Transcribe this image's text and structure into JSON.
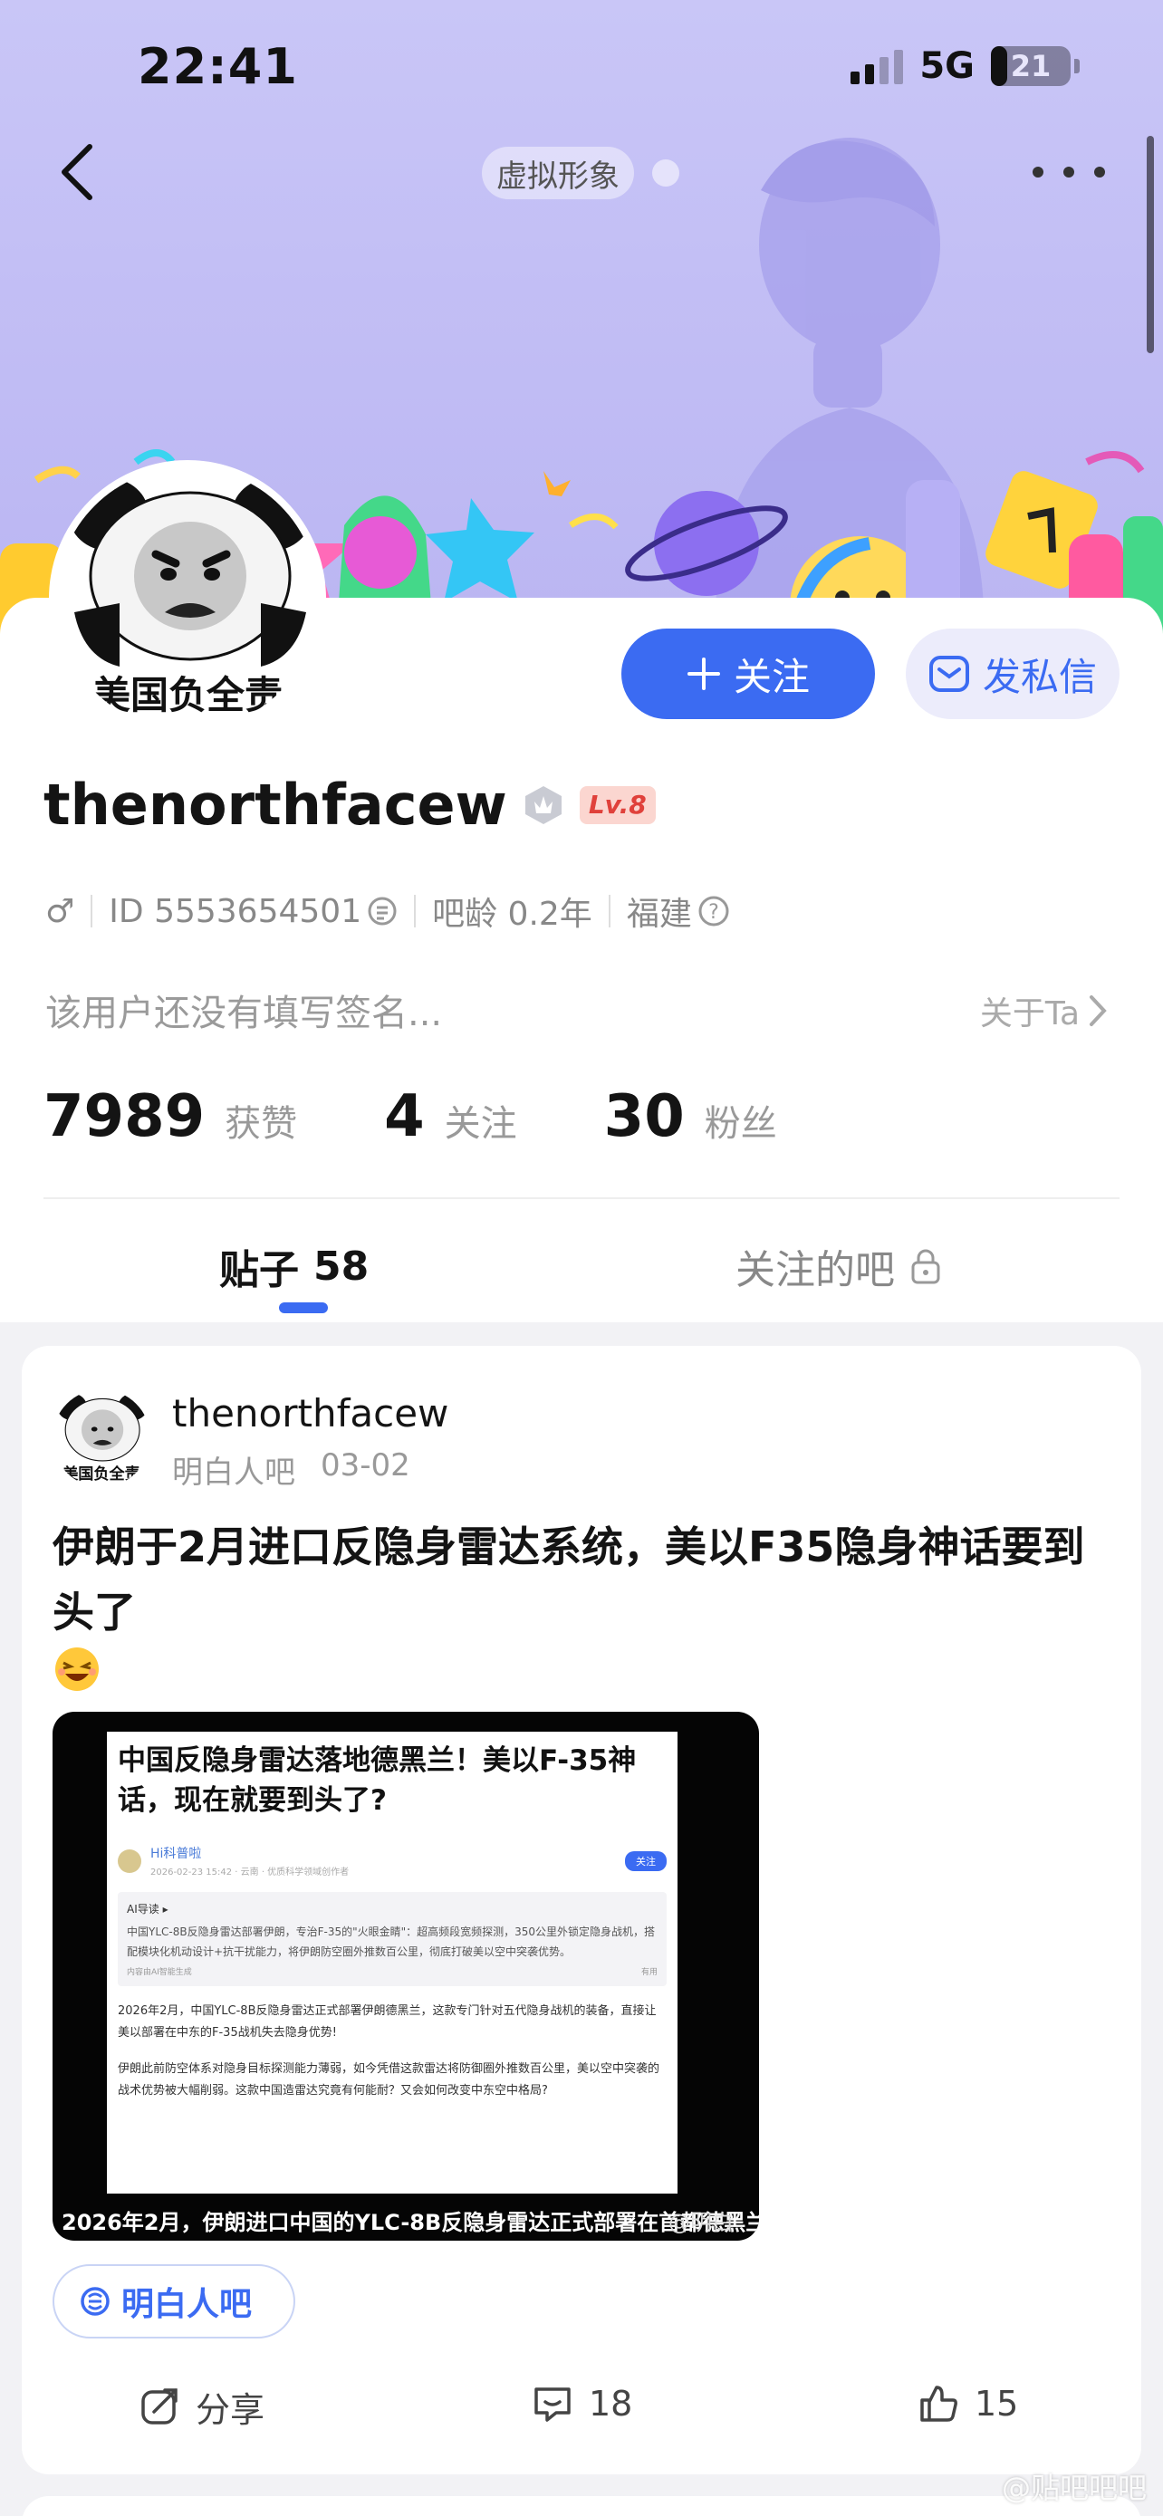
{
  "status_bar": {
    "time": "22:41",
    "network": "5G",
    "battery": "21",
    "battery_level_percent": 21
  },
  "header": {
    "avatar_tag": "虚拟形象",
    "more_icon": "more-icon",
    "back_icon": "back-icon"
  },
  "profile": {
    "follow_label": "关注",
    "message_label": "发私信",
    "username": "thenorthfacew",
    "level": "Lv.8",
    "gender_symbol": "♂",
    "id_text": "ID 5553654501",
    "bar_age": "吧龄 0.2年",
    "location": "福建",
    "bio": "该用户还没有填写签名...",
    "about_label": "关于Ta",
    "avatar_text": "美国负全责",
    "stats": [
      {
        "value": "7989",
        "label": "获赞"
      },
      {
        "value": "4",
        "label": "关注"
      },
      {
        "value": "30",
        "label": "粉丝"
      }
    ]
  },
  "tabs": [
    {
      "label": "贴子",
      "count": "58"
    },
    {
      "label": "关注的吧"
    }
  ],
  "post": {
    "author": "thenorthfacew",
    "avatar_text": "美国负全责",
    "forum": "明白人吧",
    "date": "03-02",
    "title": "伊朗于2月进口反隐身雷达系统，美以F35隐身神话要到头了",
    "image": {
      "headline": "中国反隐身雷达落地德黑兰！美以F-35神话，现在就要到头了?",
      "author": "Hi科普啦",
      "date": "2026-02-23 15:42 · 云南 · 优质科学领域创作者",
      "follow": "关注",
      "ai_title": "AI导读 ▸",
      "ai_body": "中国YLC-8B反隐身雷达部署伊朗，专治F-35的\"火眼金睛\"：超高频段宽频探测，350公里外锁定隐身战机，搭配模块化机动设计+抗干扰能力，将伊朗防空圈外推数百公里，彻底打破美以空中突袭优势。",
      "ai_foot": "内容由AI智能生成",
      "ai_useful": "有用",
      "p1": "2026年2月，中国YLC-8B反隐身雷达正式部署伊朗德黑兰，这款专门针对五代隐身战机的装备，直接让美以部署在中东的F-35战机失去隐身优势!",
      "p2": "伊朗此前防空体系对隐身目标探测能力薄弱，如今凭借这款雷达将防御圈外推数百公里，美以空中突袭的战术优势被大幅削弱。这款中国造雷达究竟有何能耐？又会如何改变中东空中格局?",
      "caption": "2026年2月，伊朗进口中国的YLC-8B反隐身雷达正式部署在首都德黑兰",
      "watermark": "@明白"
    },
    "forum_tag": "明白人吧",
    "share_label": "分享",
    "comments": "18",
    "likes": "15"
  },
  "corner_watermark": "@贴吧吧吧"
}
